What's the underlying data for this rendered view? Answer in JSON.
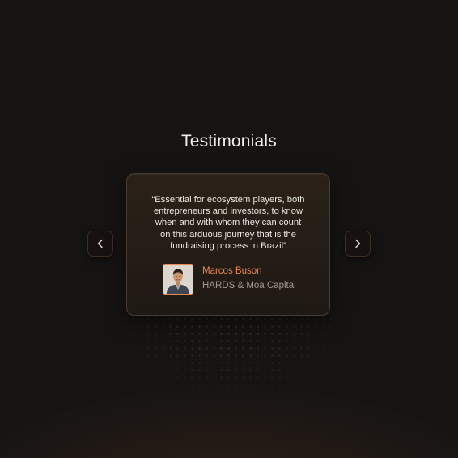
{
  "section": {
    "title": "Testimonials"
  },
  "testimonial": {
    "quote_lines": [
      "“Essential for ecosystem players, both",
      "entrepreneurs and investors, to know",
      "when and with whom they can count",
      "on this arduous journey that is the",
      "fundraising process in Brazil”"
    ],
    "author_name": "Marcos Buson",
    "author_company": "HARDS & Moa Capital"
  },
  "navigation": {
    "prev_icon": "chevron-left-icon",
    "next_icon": "chevron-right-icon"
  },
  "colors": {
    "accent": "#e8874c",
    "card_background": "#241c16",
    "page_background": "#141312"
  }
}
